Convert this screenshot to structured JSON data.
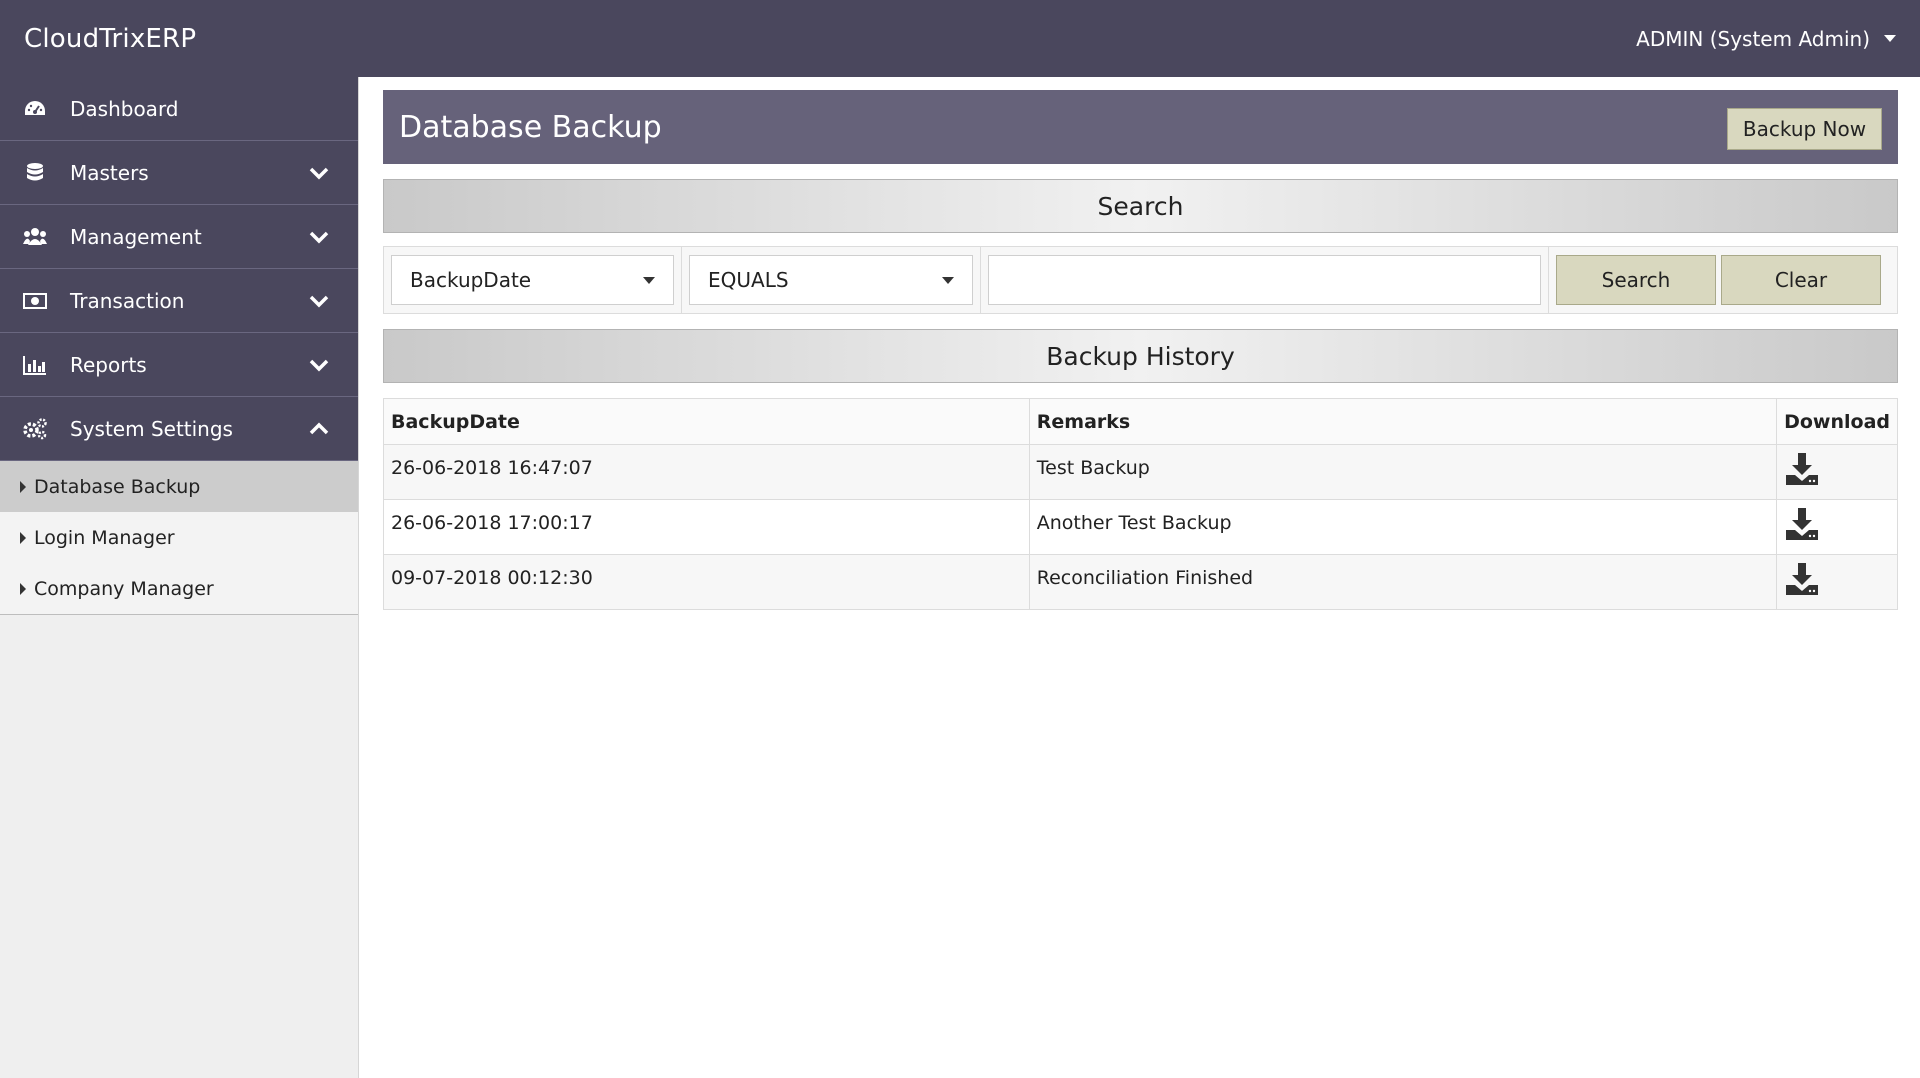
{
  "app": {
    "title": "CloudTrixERP",
    "user": "ADMIN (System Admin)"
  },
  "sidebar": {
    "items": [
      {
        "label": "Dashboard",
        "icon": "dashboard-icon"
      },
      {
        "label": "Masters",
        "icon": "database-icon"
      },
      {
        "label": "Management",
        "icon": "users-icon"
      },
      {
        "label": "Transaction",
        "icon": "money-icon"
      },
      {
        "label": "Reports",
        "icon": "bar-chart-icon"
      },
      {
        "label": "System Settings",
        "icon": "gears-icon"
      }
    ],
    "submenu": [
      {
        "label": "Database Backup",
        "active": true
      },
      {
        "label": "Login Manager"
      },
      {
        "label": "Company Manager"
      }
    ]
  },
  "page": {
    "title": "Database Backup",
    "backup_button": "Backup Now"
  },
  "search": {
    "heading": "Search",
    "field": "BackupDate",
    "operator": "EQUALS",
    "value": "",
    "search_button": "Search",
    "clear_button": "Clear"
  },
  "history": {
    "heading": "Backup History",
    "columns": [
      "BackupDate",
      "Remarks",
      "Download"
    ],
    "rows": [
      {
        "date": "26-06-2018 16:47:07",
        "remarks": "Test Backup"
      },
      {
        "date": "26-06-2018 17:00:17",
        "remarks": "Another Test Backup"
      },
      {
        "date": "09-07-2018 00:12:30",
        "remarks": "Reconciliation Finished"
      }
    ]
  },
  "colors": {
    "topbar": "#4a475d",
    "page_header": "#66627a",
    "button": "#d9d8bf",
    "sidebar_active": "#cccccc"
  }
}
